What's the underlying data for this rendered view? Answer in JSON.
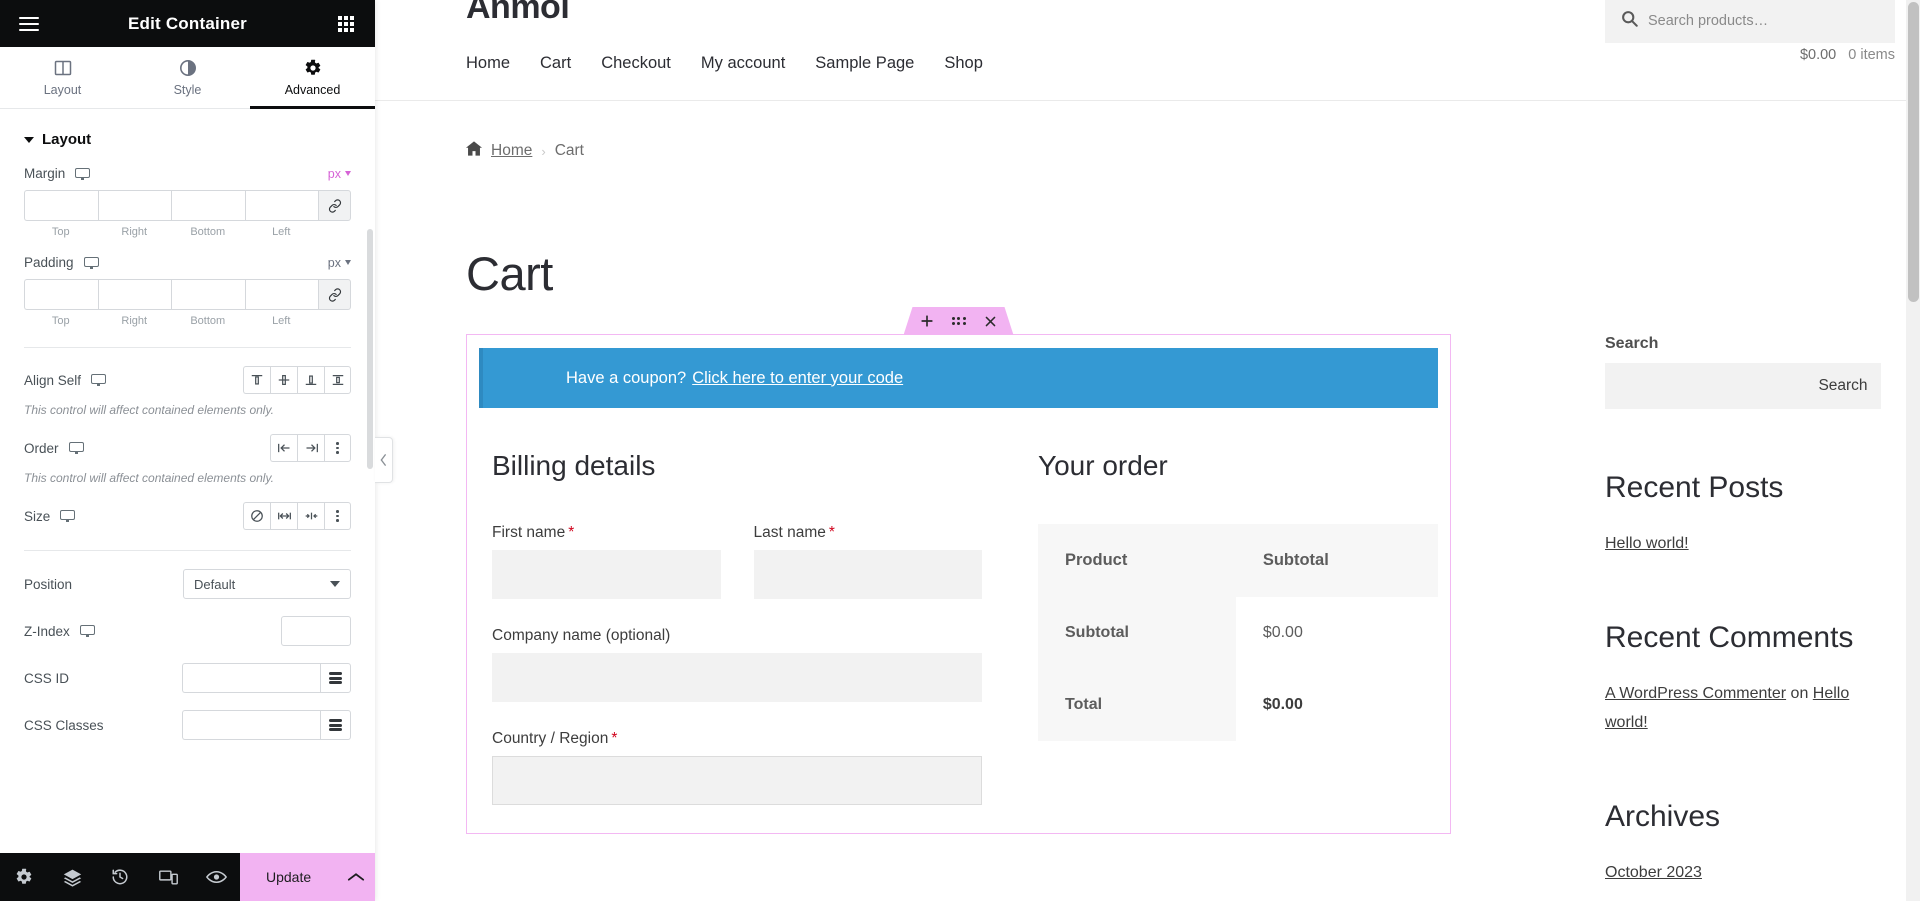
{
  "panel": {
    "title": "Edit Container",
    "menu_icon": "hamburger-icon",
    "apps_icon": "apps-grid-icon",
    "tabs": [
      {
        "label": "Layout",
        "icon": "layout-columns-icon",
        "active": false
      },
      {
        "label": "Style",
        "icon": "half-circle-icon",
        "active": false
      },
      {
        "label": "Advanced",
        "icon": "gear-icon",
        "active": true
      }
    ],
    "section": {
      "label": "Layout",
      "expanded": true
    },
    "controls": {
      "margin": {
        "label": "Margin",
        "unit": "px",
        "device_icon": "desktop-icon",
        "values": [
          "",
          "",
          "",
          ""
        ],
        "captions": [
          "Top",
          "Right",
          "Bottom",
          "Left"
        ],
        "link_icon": "link-icon"
      },
      "padding": {
        "label": "Padding",
        "unit": "px",
        "device_icon": "desktop-icon",
        "values": [
          "",
          "",
          "",
          ""
        ],
        "captions": [
          "Top",
          "Right",
          "Bottom",
          "Left"
        ],
        "link_icon": "link-icon"
      },
      "align_self": {
        "label": "Align Self",
        "device_icon": "desktop-icon",
        "options": [
          "align-start-icon",
          "align-center-icon",
          "align-end-icon",
          "align-stretch-icon"
        ],
        "hint": "This control will affect contained elements only."
      },
      "order": {
        "label": "Order",
        "device_icon": "desktop-icon",
        "options": [
          "order-start-icon",
          "order-end-icon",
          "more-options-icon"
        ],
        "hint": "This control will affect contained elements only."
      },
      "size": {
        "label": "Size",
        "device_icon": "desktop-icon",
        "options": [
          "none-icon",
          "grow-icon",
          "shrink-icon",
          "more-options-icon"
        ]
      },
      "position": {
        "label": "Position",
        "value": "Default"
      },
      "z_index": {
        "label": "Z-Index",
        "device_icon": "desktop-icon",
        "value": ""
      },
      "css_id": {
        "label": "CSS ID",
        "value": "",
        "tag_icon": "dynamic-tags-icon"
      },
      "css_classes": {
        "label": "CSS Classes",
        "value": "",
        "tag_icon": "dynamic-tags-icon"
      }
    },
    "footer": {
      "icons": [
        "settings-gear-icon",
        "navigator-layers-icon",
        "history-clock-icon",
        "responsive-devices-icon",
        "preview-eye-icon"
      ],
      "update_label": "Update",
      "arrow_icon": "chevron-up-icon"
    },
    "collapse_icon": "chevron-left-icon"
  },
  "site": {
    "brand": "Anmol",
    "search": {
      "placeholder": "Search products…",
      "icon": "search-icon"
    },
    "nav": [
      "Home",
      "Cart",
      "Checkout",
      "My account",
      "Sample Page",
      "Shop"
    ],
    "cart": {
      "amount": "$0.00",
      "items": "0 items",
      "icon": "basket-icon"
    },
    "breadcrumb": {
      "home_icon": "home-icon",
      "home": "Home",
      "separator": "›",
      "current": "Cart"
    },
    "page_title": "Cart",
    "element_handle": {
      "add_icon": "plus-icon",
      "drag_icon": "drag-dots-icon",
      "close_icon": "close-x-icon"
    },
    "coupon": {
      "text": "Have a coupon?",
      "link": "Click here to enter your code",
      "bg_color": "#3499d3"
    },
    "billing": {
      "heading": "Billing details",
      "fields": [
        {
          "label": "First name",
          "required": true,
          "value": "",
          "type": "text"
        },
        {
          "label": "Last name",
          "required": true,
          "value": "",
          "type": "text"
        },
        {
          "label": "Company name (optional)",
          "required": false,
          "value": "",
          "type": "text"
        },
        {
          "label": "Country / Region",
          "required": true,
          "value": "",
          "type": "select"
        }
      ]
    },
    "order": {
      "heading": "Your order",
      "columns": [
        "Product",
        "Subtotal"
      ],
      "rows": [
        {
          "label": "Subtotal",
          "value": "$0.00",
          "strong": false
        },
        {
          "label": "Total",
          "value": "$0.00",
          "strong": true
        }
      ]
    },
    "widgets": {
      "search": {
        "title": "Search",
        "value": "",
        "button": "Search"
      },
      "recent_posts": {
        "title": "Recent Posts",
        "items": [
          "Hello world!"
        ]
      },
      "recent_comments": {
        "title": "Recent Comments",
        "author": "A WordPress Commenter",
        "on": "on",
        "post": "Hello world!"
      },
      "archives": {
        "title": "Archives",
        "items": [
          "October 2023"
        ]
      }
    }
  }
}
